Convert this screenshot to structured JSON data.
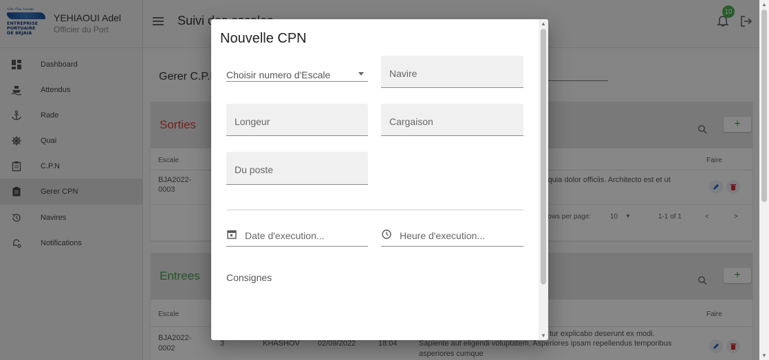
{
  "sidebar": {
    "logo": {
      "top_text": "مؤسسة ميناء بجاية",
      "line1": "ENTREPRISE",
      "line2": "PORTUAIRE",
      "line3": "DE BEJAIA"
    },
    "user_name": "YEHIAOUI Adel",
    "user_role": "Officier du Port",
    "items": [
      {
        "label": "Dashboard",
        "icon": "dashboard-icon"
      },
      {
        "label": "Attendus",
        "icon": "ship-icon"
      },
      {
        "label": "Rade",
        "icon": "anchor-icon"
      },
      {
        "label": "Quai",
        "icon": "helm-icon"
      },
      {
        "label": "C.P.N",
        "icon": "clipboard-icon"
      },
      {
        "label": "Gerer CPN",
        "icon": "clipboard-filled-icon"
      },
      {
        "label": "Navires",
        "icon": "history-icon"
      },
      {
        "label": "Notifications",
        "icon": "bell-settings-icon"
      }
    ]
  },
  "topbar": {
    "title": "Suivi des escales",
    "notification_count": "10"
  },
  "main": {
    "page_title": "Gerer C.P.N",
    "sorties": {
      "title": "Sorties",
      "col_escale": "Escale",
      "col_faire": "Faire",
      "row": {
        "escale_line1": "BJA2022-",
        "escale_line2": "0003",
        "text": "i quia dolor officiis. Architecto est et ut"
      },
      "rows_per_page_label": "Rows per page:",
      "rows_per_page_value": "10",
      "range": "1-1 of 1"
    },
    "entrees": {
      "title": "Entrees",
      "col_escale": "Escale",
      "col_faire": "Faire",
      "row": {
        "escale_line1": "BJA2022-",
        "escale_line2": "0002",
        "num": "3",
        "navire": "KHASHOV",
        "date": "02/09/2022",
        "heure": "18:04",
        "text1": "tur explicabo deserunt ex modi.",
        "text2": "Sapiente aut eligendi voluptatem. Asperiores ipsam repellendus temporibus",
        "text3": "asperiores cumque"
      }
    }
  },
  "dialog": {
    "title": "Nouvelle CPN",
    "escale_select": "Choisir numero d'Escale",
    "navire": "Navire",
    "longeur": "Longeur",
    "cargaison": "Cargaison",
    "du_poste": "Du poste",
    "date_execution": "Date d'execution...",
    "heure_execution": "Heure d'execution...",
    "consignes": "Consignes"
  },
  "colors": {
    "sorties": "#e53935",
    "entrees": "#43a047",
    "badge": "#4caf50"
  }
}
